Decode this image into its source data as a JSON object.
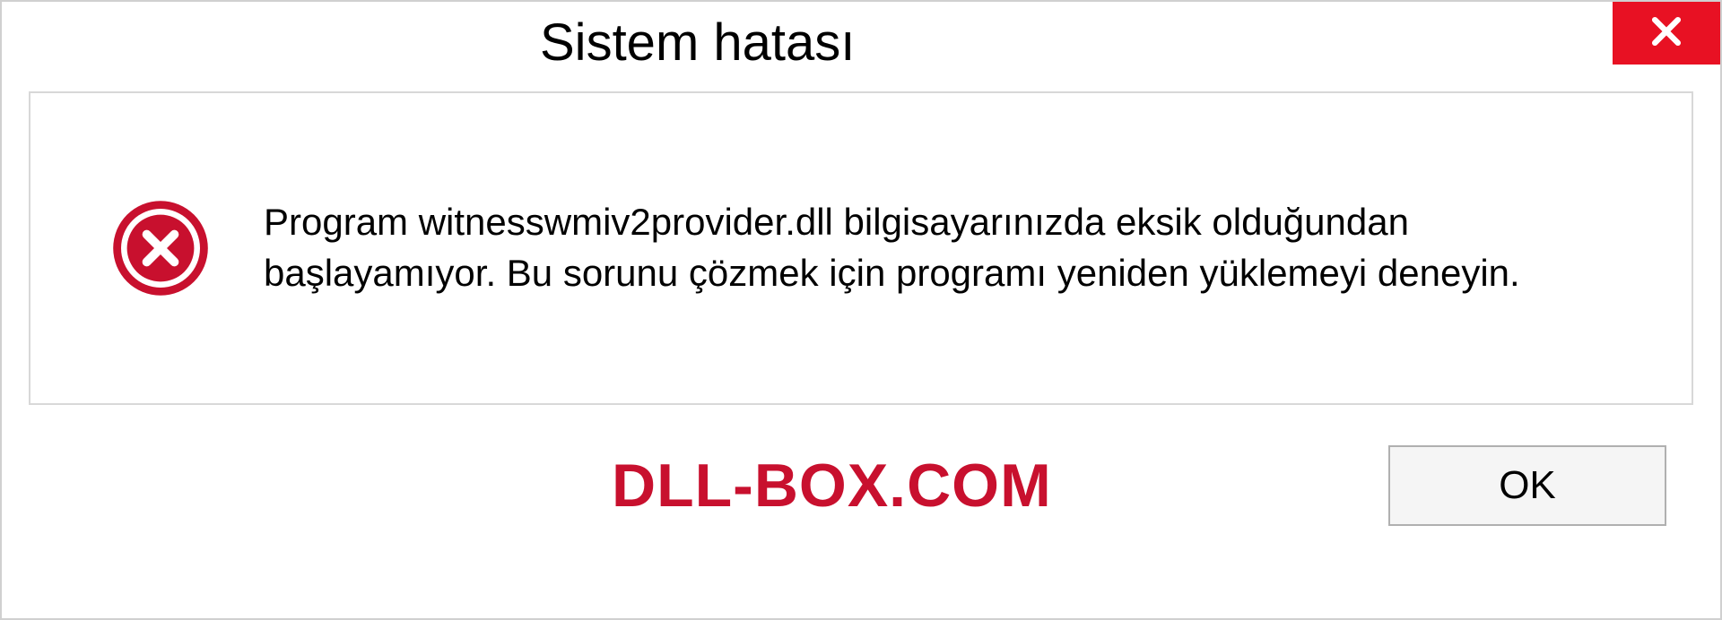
{
  "titlebar": {
    "title": "Sistem hatası"
  },
  "message": {
    "text": "Program witnesswmiv2provider.dll bilgisayarınızda eksik olduğundan başlayamıyor. Bu sorunu çözmek için programı yeniden yüklemeyi deneyin."
  },
  "footer": {
    "watermark": "DLL-BOX.COM",
    "ok_label": "OK"
  }
}
